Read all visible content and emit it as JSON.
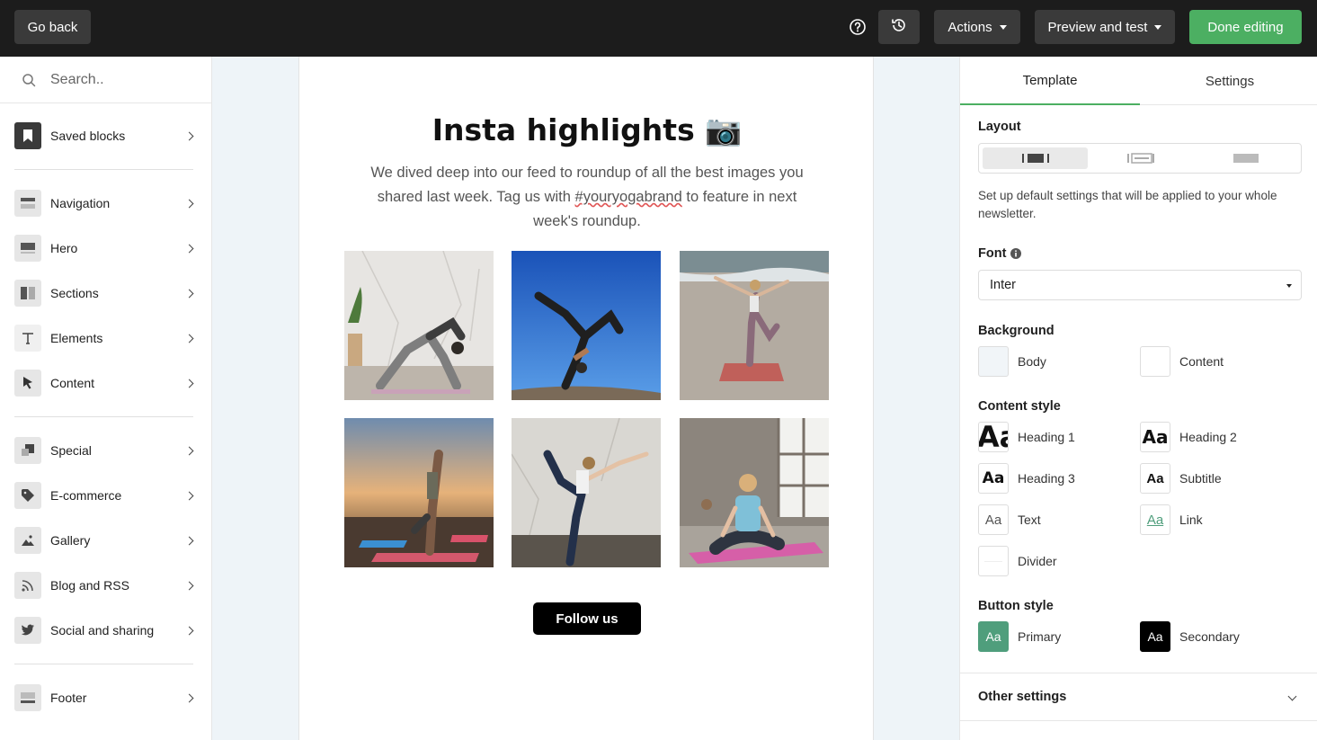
{
  "topbar": {
    "back_label": "Go back",
    "help_icon": "question-circle-icon",
    "history_icon": "history-icon",
    "actions_label": "Actions",
    "preview_label": "Preview and test",
    "done_label": "Done editing"
  },
  "sidebar": {
    "search_placeholder": "Search..",
    "items": [
      {
        "label": "Saved blocks",
        "icon": "bookmark-icon"
      },
      {
        "label": "Navigation",
        "icon": "navigation-icon"
      },
      {
        "label": "Hero",
        "icon": "hero-icon"
      },
      {
        "label": "Sections",
        "icon": "sections-icon"
      },
      {
        "label": "Elements",
        "icon": "text-icon"
      },
      {
        "label": "Content",
        "icon": "cursor-icon"
      },
      {
        "label": "Special",
        "icon": "special-icon"
      },
      {
        "label": "E-commerce",
        "icon": "tag-icon"
      },
      {
        "label": "Gallery",
        "icon": "image-icon"
      },
      {
        "label": "Blog and RSS",
        "icon": "rss-icon"
      },
      {
        "label": "Social and sharing",
        "icon": "twitter-icon"
      },
      {
        "label": "Footer",
        "icon": "footer-icon"
      }
    ]
  },
  "email": {
    "title": "Insta highlights 📷",
    "text_before": "We dived deep into our feed to roundup of all the best images you shared last week. Tag us with ",
    "hashtag": "#youryogabrand",
    "text_after": " to feature in next week's roundup.",
    "button_label": "Follow us",
    "photos": [
      "yoga-photo-1",
      "yoga-photo-2",
      "yoga-photo-3",
      "yoga-photo-4",
      "yoga-photo-5",
      "yoga-photo-6"
    ]
  },
  "panel": {
    "tabs": [
      "Template",
      "Settings"
    ],
    "active_tab": "Template",
    "layout_label": "Layout",
    "layout_help": "Set up default settings that will be applied to your whole newsletter.",
    "font_label": "Font",
    "font_value": "Inter",
    "background_label": "Background",
    "background": {
      "body": "Body",
      "content": "Content",
      "body_color": "#f1f5f8",
      "content_color": "#ffffff"
    },
    "content_style_label": "Content style",
    "content_styles": {
      "heading1": "Heading 1",
      "heading2": "Heading 2",
      "heading3": "Heading 3",
      "subtitle": "Subtitle",
      "text": "Text",
      "link": "Link",
      "divider": "Divider",
      "glyph": "Aa"
    },
    "button_style_label": "Button style",
    "buttons": {
      "primary": "Primary",
      "secondary": "Secondary",
      "primary_color": "#4f9e7c",
      "secondary_color": "#000000"
    },
    "other_settings": "Other settings"
  },
  "colors": {
    "accent": "#4caf62",
    "topbar": "#1c1c1c"
  }
}
